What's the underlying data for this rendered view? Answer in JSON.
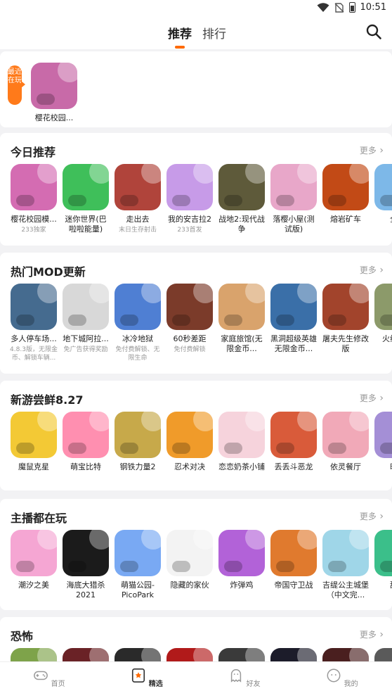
{
  "status": {
    "time": "10:51"
  },
  "tabs": [
    {
      "label": "推荐"
    },
    {
      "label": "排行"
    }
  ],
  "recent": {
    "tag": "最近在玩",
    "games": [
      {
        "name": "樱花校园...",
        "color": "#c86aa8"
      }
    ]
  },
  "sections": [
    {
      "title": "今日推荐",
      "more": "更多",
      "games": [
        {
          "name": "樱花校园模...",
          "sub": "233独家",
          "color": "#d46cb2"
        },
        {
          "name": "迷你世界(巴啦啦能量)",
          "sub": "",
          "color": "#3fbf5a"
        },
        {
          "name": "走出去",
          "sub": "末日生存射击",
          "color": "#b0443b"
        },
        {
          "name": "我的安吉拉2",
          "sub": "233首发",
          "color": "#c79be8"
        },
        {
          "name": "战地2:现代战争",
          "sub": "",
          "color": "#5e5a3a"
        },
        {
          "name": "落樱小屋(测试版)",
          "sub": "",
          "color": "#e8a7c9"
        },
        {
          "name": "熔岩矿车",
          "sub": "",
          "color": "#c24a16"
        },
        {
          "name": "全心",
          "sub": "",
          "color": "#7db8e8"
        }
      ]
    },
    {
      "title": "热门MOD更新",
      "more": "更多",
      "games": [
        {
          "name": "多人停车场...",
          "sub": "4.8.3版，无限金币、解锁车辆...",
          "color": "#456b8f"
        },
        {
          "name": "地下城阿拉...",
          "sub": "免广告获得奖励",
          "color": "#d8d8d8"
        },
        {
          "name": "冰冷地狱",
          "sub": "免付费解锁、无限生命",
          "color": "#4f7fd3"
        },
        {
          "name": "60秒差距",
          "sub": "免付费解锁",
          "color": "#7b3b2a"
        },
        {
          "name": "家庭旅馆(无限金币...",
          "sub": "",
          "color": "#d9a36c"
        },
        {
          "name": "黑洞超级英雄无限金币...",
          "sub": "",
          "color": "#3a6fa8"
        },
        {
          "name": "屠夫先生修改版",
          "sub": "",
          "color": "#a2442c"
        },
        {
          "name": "火线限金",
          "sub": "",
          "color": "#8c9a6a"
        }
      ]
    },
    {
      "title": "新游尝鲜8.27",
      "more": "更多",
      "games": [
        {
          "name": "魔鼠克星",
          "sub": "",
          "color": "#f3c935"
        },
        {
          "name": "萌宝比特",
          "sub": "",
          "color": "#ff8fb0"
        },
        {
          "name": "钢铁力量2",
          "sub": "",
          "color": "#c7a94a"
        },
        {
          "name": "忍术对决",
          "sub": "",
          "color": "#f09b2a"
        },
        {
          "name": "恋恋奶茶小铺",
          "sub": "",
          "color": "#f6d3dc"
        },
        {
          "name": "丢丢斗恶龙",
          "sub": "",
          "color": "#d95b3a"
        },
        {
          "name": "依灵餐厅",
          "sub": "",
          "color": "#f1a9b8"
        },
        {
          "name": "时光",
          "sub": "",
          "color": "#a48fd6"
        }
      ]
    },
    {
      "title": "主播都在玩",
      "more": "更多",
      "games": [
        {
          "name": "潮汐之美",
          "sub": "",
          "color": "#f5a6d3"
        },
        {
          "name": "海底大猎杀2021",
          "sub": "",
          "color": "#1b1b1b"
        },
        {
          "name": "萌猫公园-PicoPark",
          "sub": "",
          "color": "#79a9f3"
        },
        {
          "name": "隐藏的家伙",
          "sub": "",
          "color": "#f3f3f3"
        },
        {
          "name": "炸弹鸡",
          "sub": "",
          "color": "#b262d8"
        },
        {
          "name": "帝国守卫战",
          "sub": "",
          "color": "#e07a2e"
        },
        {
          "name": "吉缇公主城堡（中文完...",
          "sub": "",
          "color": "#9fd6e8"
        },
        {
          "name": "甜甜",
          "sub": "",
          "color": "#3bbf8a"
        }
      ]
    },
    {
      "title": "恐怖",
      "more": "更多",
      "games": [
        {
          "name": "",
          "sub": "",
          "color": "#7ea34a"
        },
        {
          "name": "",
          "sub": "",
          "color": "#6a2226"
        },
        {
          "name": "",
          "sub": "",
          "color": "#2a2a2a"
        },
        {
          "name": "",
          "sub": "",
          "color": "#b11a1a"
        },
        {
          "name": "",
          "sub": "",
          "color": "#3a3a3a"
        },
        {
          "name": "",
          "sub": "",
          "color": "#1c1c2a"
        },
        {
          "name": "",
          "sub": "",
          "color": "#4a1f1f"
        },
        {
          "name": "",
          "sub": "",
          "color": "#5a5a5a"
        }
      ]
    }
  ],
  "bottomnav": [
    {
      "label": "首页",
      "icon": "gamepad-icon"
    },
    {
      "label": "精选",
      "icon": "star-badge-icon"
    },
    {
      "label": "好友",
      "icon": "ghost-icon"
    },
    {
      "label": "我的",
      "icon": "smile-icon"
    }
  ],
  "colors": {
    "accent": "#ff6a00"
  }
}
